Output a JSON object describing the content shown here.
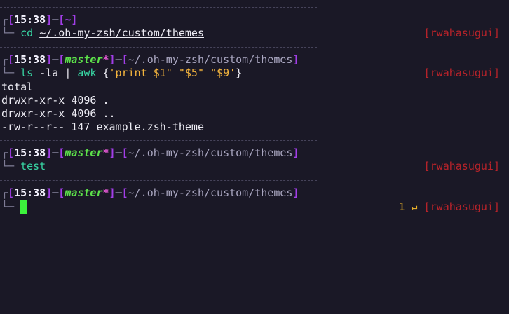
{
  "theme": {
    "background": "#1a1826",
    "separator": "#46435a",
    "prompt_frame": "#7f7c96",
    "bracket": "#a23ee8",
    "branch": "#5ce04a",
    "command": "#38d6a4",
    "string": "#f2b33d",
    "host": "#b8232a",
    "cursor": "#3cf23c"
  },
  "prompt_glyphs": {
    "corner_top": "┌",
    "corner_bottom": "└─",
    "dash": "─",
    "open": "[",
    "close": "]",
    "dirty_marker": "*"
  },
  "blocks": [
    {
      "time": "15:38",
      "cwd": "~",
      "command": "cd",
      "args": "~/.oh-my-zsh/custom/themes",
      "host": "[rwahasugui]"
    },
    {
      "time": "15:38",
      "branch": "master",
      "cwd": "~/.oh-my-zsh/custom/themes",
      "command": "ls",
      "args": "-la",
      "pipe": "|",
      "command2": "awk",
      "brace_open": "{",
      "string1": "'print $1\"",
      "string2": "\"$5\"",
      "string3": "\"$9'",
      "brace_close": "}",
      "host": "[rwahasugui]",
      "output": [
        "total",
        "drwxr-xr-x 4096 .",
        "drwxr-xr-x 4096 ..",
        "-rw-r--r-- 147 example.zsh-theme"
      ]
    },
    {
      "time": "15:38",
      "branch": "master",
      "cwd": "~/.oh-my-zsh/custom/themes",
      "command": "test",
      "host": "[rwahasugui]"
    },
    {
      "time": "15:38",
      "branch": "master",
      "cwd": "~/.oh-my-zsh/custom/themes",
      "return_code": "1 ↵",
      "host": "[rwahasugui]"
    }
  ]
}
